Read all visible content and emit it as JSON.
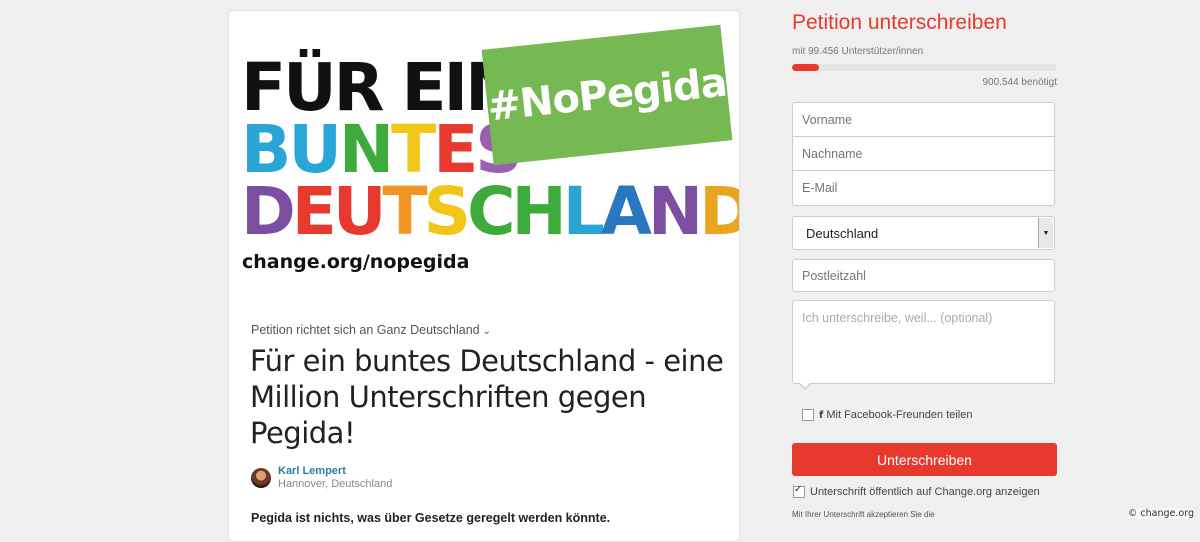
{
  "banner": {
    "line1": "FÜR EIN",
    "line2_letters": [
      "B",
      "U",
      "N",
      "T",
      "E",
      "S"
    ],
    "line2_colors": [
      "#2aa3d5",
      "#29a6d8",
      "#3daa3c",
      "#f2c519",
      "#e8392e",
      "#9b5fb0"
    ],
    "line3_letters": [
      "D",
      "E",
      "U",
      "T",
      "S",
      "C",
      "H",
      "L",
      "A",
      "N",
      "D"
    ],
    "line3_colors": [
      "#7b4ea1",
      "#e8392e",
      "#e8392e",
      "#f29623",
      "#f2c519",
      "#3daa3c",
      "#3daa3c",
      "#2aa3d5",
      "#2a76c0",
      "#7b4ea1",
      "#e8a51f"
    ],
    "exclamation": "!",
    "hashtag": "#NoPegida",
    "url": "change.org/nopegida"
  },
  "petition": {
    "target": "Petition richtet sich an Ganz Deutschland",
    "chevron": "⌄",
    "title": "Für ein buntes Deutschland - eine Million Unterschriften gegen Pegida!",
    "author_name": "Karl Lempert",
    "author_location": "Hannover, Deutschland",
    "lead": "Pegida ist nichts, was über Gesetze geregelt werden könnte."
  },
  "sign": {
    "heading": "Petition unterschreiben",
    "supporters": "mit 99.456 Unterstützer/innen",
    "progress_fraction": 0.1,
    "needed": "900.544 benötigt",
    "first_name_placeholder": "Vorname",
    "last_name_placeholder": "Nachname",
    "email_placeholder": "E-Mail",
    "country": "Deutschland",
    "zip_placeholder": "Postleitzahl",
    "reason_placeholder": "Ich unterschreibe, weil... (optional)",
    "facebook_icon": "f",
    "facebook_label": "Mit Facebook-Freunden teilen",
    "button": "Unterschreiben",
    "public_label": "Unterschrift öffentlich auf Change.org anzeigen",
    "terms": "Mit Ihrer Unterschrift akzeptieren Sie die"
  },
  "credit": "© change.org",
  "colors": {
    "accent": "#e8392e",
    "hashtag_bg": "#76b852",
    "link": "#2a7fa3"
  }
}
